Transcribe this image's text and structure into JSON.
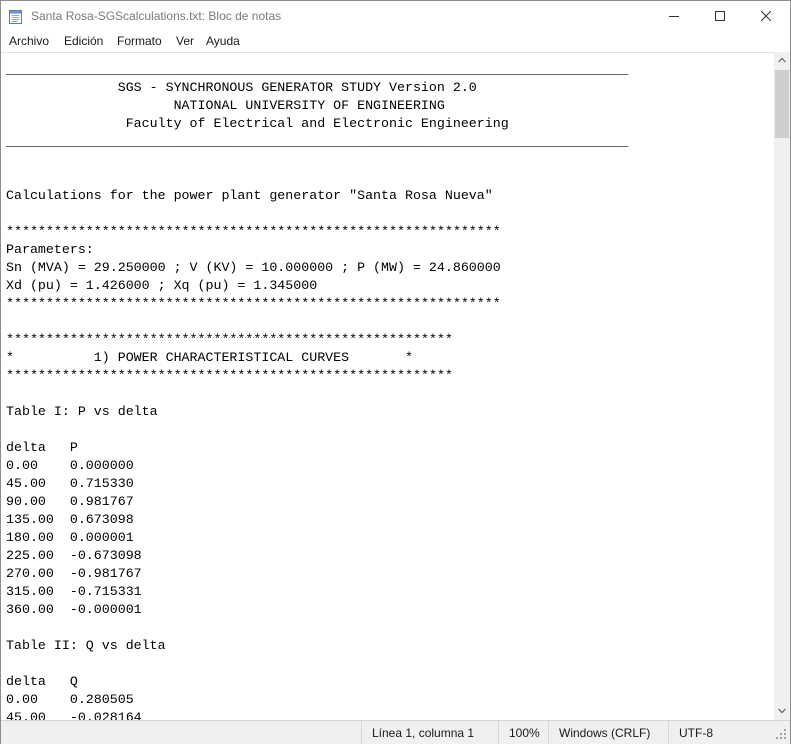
{
  "window": {
    "title": "Santa Rosa-SGScalculations.txt: Bloc de notas"
  },
  "menu": {
    "items": [
      "Archivo",
      "Edición",
      "Formato",
      "Ver",
      "Ayuda"
    ]
  },
  "editor": {
    "text": "______________________________________________________________________________\n              SGS - SYNCHRONOUS GENERATOR STUDY Version 2.0\n                     NATIONAL UNIVERSITY OF ENGINEERING\n               Faculty of Electrical and Electronic Engineering\n______________________________________________________________________________\n\n\nCalculations for the power plant generator \"Santa Rosa Nueva\"\n\n**************************************************************\nParameters:\nSn (MVA) = 29.250000 ; V (KV) = 10.000000 ; P (MW) = 24.860000\nXd (pu) = 1.426000 ; Xq (pu) = 1.345000\n**************************************************************\n\n********************************************************\n*          1) POWER CHARACTERISTICAL CURVES       *\n********************************************************\n\nTable I: P vs delta\n\ndelta   P\n0.00    0.000000\n45.00   0.715330\n90.00   0.981767\n135.00  0.673098\n180.00  0.000001\n225.00  -0.673098\n270.00  -0.981767\n315.00  -0.715331\n360.00  -0.000001\n\nTable II: Q vs delta\n\ndelta   Q\n0.00    0.280505\n45.00   -0.028164"
  },
  "status": {
    "position": "Línea 1, columna 1",
    "zoom": "100%",
    "line_ending": "Windows (CRLF)",
    "encoding": "UTF-8"
  },
  "icons": {
    "app": "notepad-icon",
    "minimize": "minimize-icon",
    "maximize": "maximize-icon",
    "close": "close-icon"
  }
}
